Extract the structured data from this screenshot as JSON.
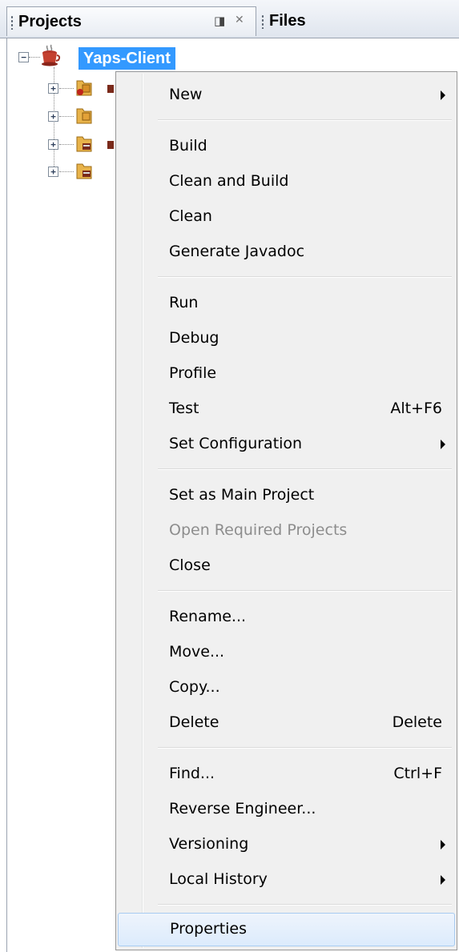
{
  "tabs": {
    "projects_label": "Projects",
    "files_label": "Files",
    "minimize_glyph": "◨",
    "close_glyph": "✕"
  },
  "tree": {
    "root": {
      "label": "Yaps-Client",
      "expanded": true,
      "toggle_glyph": "−",
      "icon": "coffee-cup-project-icon"
    },
    "children": [
      {
        "toggle_glyph": "+",
        "icon": "source-packages-folder-icon"
      },
      {
        "toggle_glyph": "+",
        "icon": "test-packages-folder-icon"
      },
      {
        "toggle_glyph": "+",
        "icon": "libraries-folder-icon"
      },
      {
        "toggle_glyph": "+",
        "icon": "test-libraries-folder-icon"
      }
    ]
  },
  "context_menu": {
    "groups": [
      [
        {
          "label": "New",
          "submenu": true
        }
      ],
      [
        {
          "label": "Build"
        },
        {
          "label": "Clean and Build"
        },
        {
          "label": "Clean"
        },
        {
          "label": "Generate Javadoc"
        }
      ],
      [
        {
          "label": "Run"
        },
        {
          "label": "Debug"
        },
        {
          "label": "Profile"
        },
        {
          "label": "Test",
          "shortcut": "Alt+F6"
        },
        {
          "label": "Set Configuration",
          "submenu": true
        }
      ],
      [
        {
          "label": "Set as Main Project"
        },
        {
          "label": "Open Required Projects",
          "disabled": true
        },
        {
          "label": "Close"
        }
      ],
      [
        {
          "label": "Rename..."
        },
        {
          "label": "Move..."
        },
        {
          "label": "Copy..."
        },
        {
          "label": "Delete",
          "shortcut": "Delete"
        }
      ],
      [
        {
          "label": "Find...",
          "shortcut": "Ctrl+F"
        },
        {
          "label": "Reverse Engineer..."
        },
        {
          "label": "Versioning",
          "submenu": true
        },
        {
          "label": "Local History",
          "submenu": true
        }
      ],
      [
        {
          "label": "Properties",
          "highlighted": true
        }
      ]
    ]
  },
  "colors": {
    "selection": "#3399ff",
    "menu_background": "#f0f0f0",
    "disabled_text": "#8d8d8d",
    "hover_border": "#a8cbf1"
  }
}
